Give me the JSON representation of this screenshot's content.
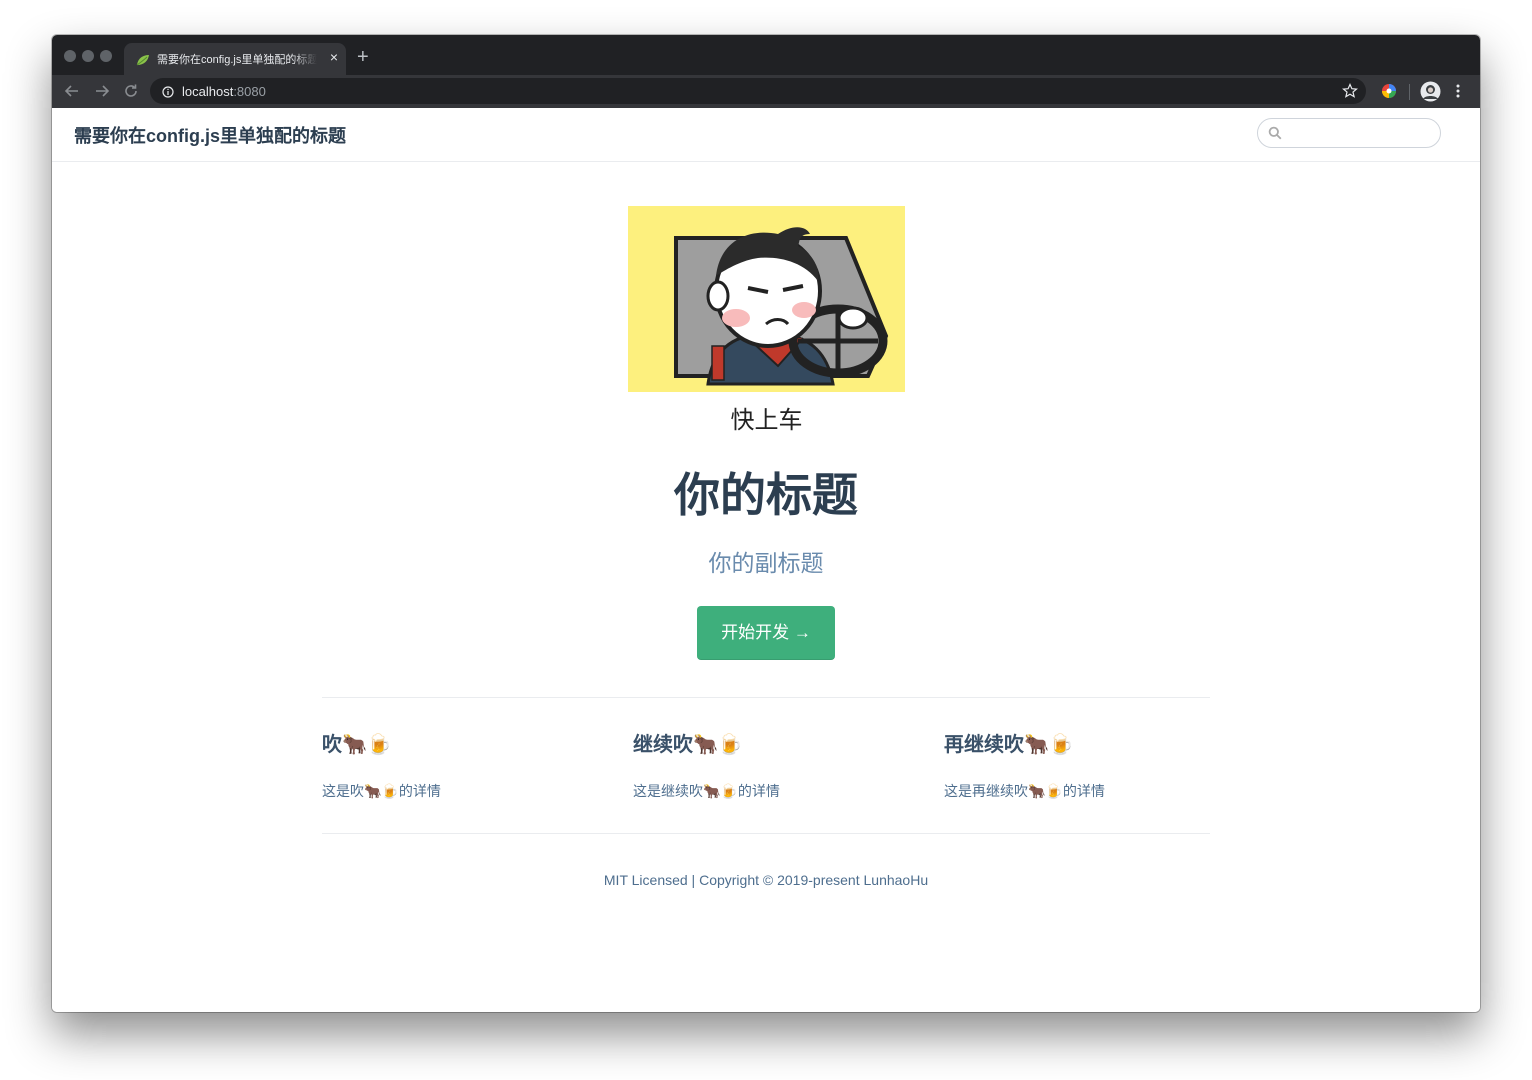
{
  "browser": {
    "tab_title": "需要你在config.js里单独配的标题",
    "tab_close": "×",
    "new_tab": "+",
    "url_host": "localhost",
    "url_port": ":8080"
  },
  "navbar": {
    "site_title": "需要你在config.js里单独配的标题",
    "search_placeholder": ""
  },
  "hero": {
    "image_caption": "快上车",
    "title": "你的标题",
    "description": "你的副标题",
    "action_text": "开始开发 →"
  },
  "features": [
    {
      "title": "吹🐂🍺",
      "details": "这是吹🐂🍺的详情"
    },
    {
      "title": "继续吹🐂🍺",
      "details": "这是继续吹🐂🍺的详情"
    },
    {
      "title": "再继续吹🐂🍺",
      "details": "这是再继续吹🐂🍺的详情"
    }
  ],
  "footer": {
    "text": "MIT Licensed | Copyright © 2019-present LunhaoHu"
  },
  "colors": {
    "accent": "#3eaf7c",
    "heading": "#2c3e50",
    "subtitle": "#6a8bad",
    "chrome_dark": "#202124"
  }
}
